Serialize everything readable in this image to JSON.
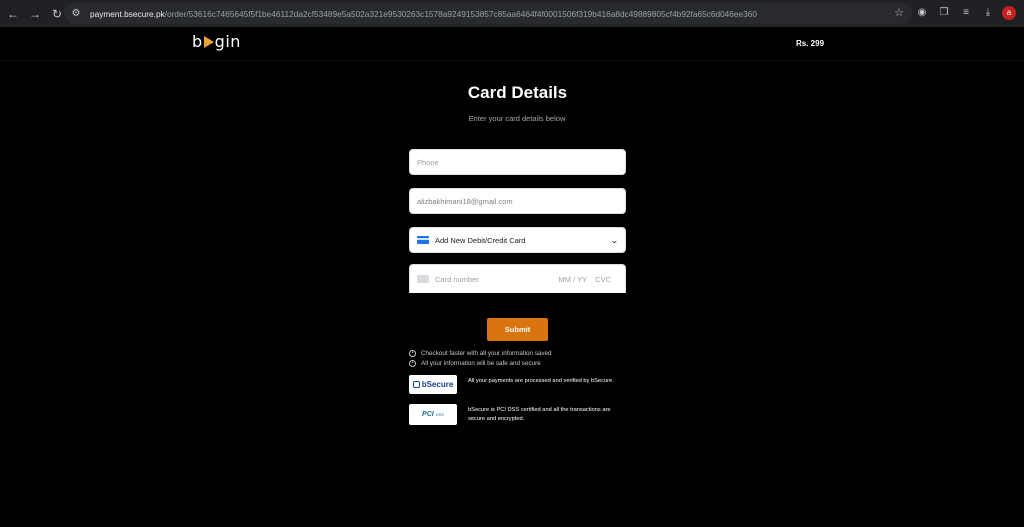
{
  "browser": {
    "url_host": "payment.bsecure.pk",
    "url_path": "/order/53616c7465645f5f1be46112da2cf53489e5a502a321e9530263c1578a9249153857c85aa6464f4f0001506f319b416a8dc49889805cf4b92fa65c6d046ee360",
    "profile_initial": "a"
  },
  "header": {
    "logo_prefix": "b",
    "logo_suffix": "gin",
    "price": "Rs. 299"
  },
  "form": {
    "title": "Card Details",
    "subtitle": "Enter your card details below",
    "phone_placeholder": "Phone",
    "email_value": "alizbakhimani18@gmail.com",
    "card_select_label": "Add New Debit/Credit Card",
    "card_number_placeholder": "Card number",
    "expiry_placeholder": "MM / YY",
    "cvc_placeholder": "CVC",
    "submit_label": "Submit"
  },
  "info": {
    "line1": "Checkout faster with all your information saved",
    "line2": "All your information will be safe and secure"
  },
  "badges": {
    "bsecure_label": "bSecure",
    "bsecure_text": "All your payments are processed and verified by bSecure.",
    "pci_label": "PCI",
    "pci_sub": "DSS",
    "pci_text": "bSecure is PCI DSS certified and all the transactions are secure and encrypted."
  },
  "colors": {
    "accent": "#d9740e",
    "background": "#000000"
  }
}
